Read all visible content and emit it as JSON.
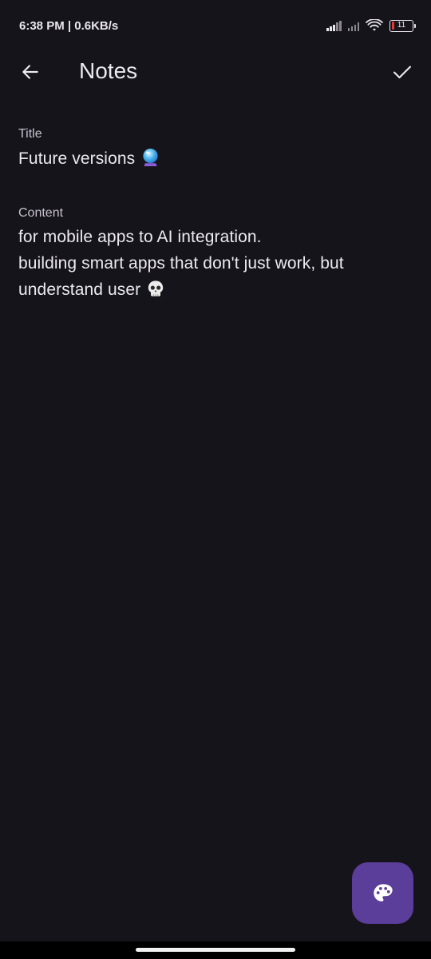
{
  "status_bar": {
    "time_speed": "6:38 PM | 0.6KB/s",
    "battery_level": "11"
  },
  "app_bar": {
    "title": "Notes",
    "back_icon": "arrow-left-icon",
    "save_icon": "check-icon"
  },
  "form": {
    "title_label": "Title",
    "title_value": "Future versions",
    "title_emoji": "crystal-ball-emoji",
    "content_label": "Content",
    "content_lines": [
      "for mobile apps to AI integration.",
      "building smart apps that don't just work, but",
      "understand user"
    ],
    "content_emoji": "skull-emoji"
  },
  "fab": {
    "icon": "palette-icon",
    "color": "#5b3d9a"
  },
  "colors": {
    "background": "#16141b",
    "text": "#ece9f1",
    "label": "#c6c2cc",
    "accent": "#5b3d9a"
  }
}
